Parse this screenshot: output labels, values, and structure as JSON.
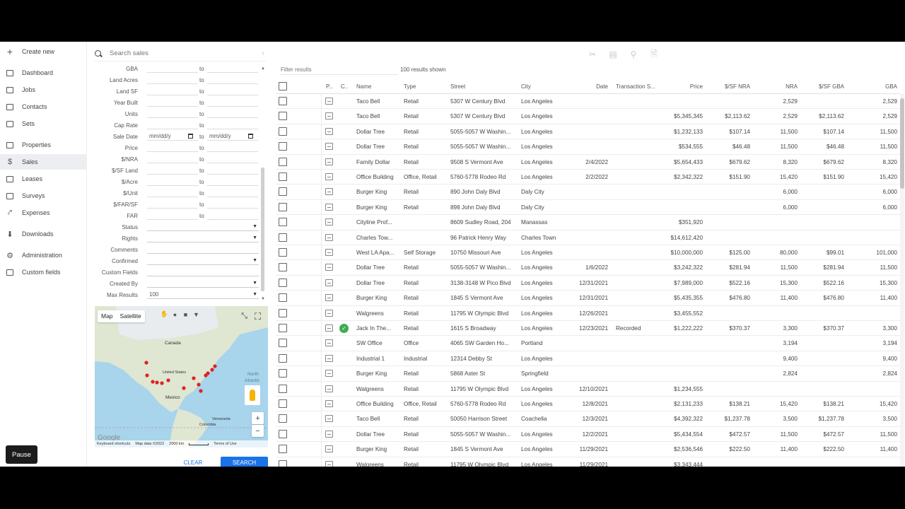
{
  "nav": {
    "create": "Create new",
    "items": [
      {
        "label": "Dashboard",
        "icon": "dashboard-icon"
      },
      {
        "label": "Jobs",
        "icon": "jobs-icon"
      },
      {
        "label": "Contacts",
        "icon": "contacts-icon"
      },
      {
        "label": "Sets",
        "icon": "sets-icon"
      },
      {
        "label": "Properties",
        "icon": "properties-icon"
      },
      {
        "label": "Sales",
        "icon": "dollar-icon",
        "active": true
      },
      {
        "label": "Leases",
        "icon": "leases-icon"
      },
      {
        "label": "Surveys",
        "icon": "surveys-icon"
      },
      {
        "label": "Expenses",
        "icon": "expenses-icon"
      },
      {
        "label": "Downloads",
        "icon": "download-icon"
      },
      {
        "label": "Administration",
        "icon": "gear-icon"
      },
      {
        "label": "Custom fields",
        "icon": "custom-fields-icon"
      }
    ],
    "pause": "Pause"
  },
  "panel": {
    "search_placeholder": "Search sales",
    "to": "to",
    "date_placeholder": "mm/dd/y",
    "filters": [
      "GBA",
      "Land Acres",
      "Land SF",
      "Year Built",
      "Units",
      "Cap Rate",
      "Sale Date",
      "Price",
      "$/NRA",
      "$/SF Land",
      "$/Acre",
      "$/Unit",
      "$/FAR/SF",
      "FAR"
    ],
    "selects": [
      {
        "label": "Status",
        "value": ""
      },
      {
        "label": "Rights",
        "value": ""
      },
      {
        "label": "Comments",
        "value": ""
      },
      {
        "label": "Confirmed",
        "value": ""
      },
      {
        "label": "Custom Fields",
        "value": ""
      },
      {
        "label": "Created By",
        "value": ""
      },
      {
        "label": "Max Results",
        "value": "100"
      }
    ],
    "map": {
      "map_label": "Map",
      "satellite_label": "Satellite",
      "labels": {
        "canada": "Canada",
        "us": "United States",
        "mexico": "Mexico",
        "north": "North",
        "atlantic": "Atlantic",
        "venezuela": "Venezuela",
        "colombia": "Colombia"
      },
      "footer": {
        "shortcuts": "Keyboard shortcuts",
        "data": "Map data ©2022",
        "scale": "2000 km",
        "terms": "Terms of Use"
      },
      "google": "Google"
    },
    "clear": "CLEAR",
    "search": "SEARCH"
  },
  "results": {
    "filter_placeholder": "Filter results",
    "count": "100 results shown",
    "headers": {
      "p": "P...",
      "c": "C...",
      "name": "Name",
      "type": "Type",
      "street": "Street",
      "city": "City",
      "date": "Date",
      "trans": "Transaction S...",
      "price": "Price",
      "sfnra": "$/SF NRA",
      "nra": "NRA",
      "sfgba": "$/SF GBA",
      "gba": "GBA"
    },
    "rows": [
      {
        "name": "Taco Bell",
        "type": "Retail",
        "street": "5307 W Century Blvd",
        "city": "Los Angeles",
        "date": "",
        "trans": "",
        "price": "",
        "sfnra": "",
        "nra": "2,529",
        "sfgba": "",
        "gba": "2,529",
        "check": false
      },
      {
        "name": "Taco Bell",
        "type": "Retail",
        "street": "5307 W Century Blvd",
        "city": "Los Angeles",
        "date": "",
        "trans": "",
        "price": "$5,345,345",
        "sfnra": "$2,113.62",
        "nra": "2,529",
        "sfgba": "$2,113.62",
        "gba": "2,529",
        "check": false
      },
      {
        "name": "Dollar Tree",
        "type": "Retail",
        "street": "5055-5057 W Washin...",
        "city": "Los Angeles",
        "date": "",
        "trans": "",
        "price": "$1,232,133",
        "sfnra": "$107.14",
        "nra": "11,500",
        "sfgba": "$107.14",
        "gba": "11,500",
        "check": false
      },
      {
        "name": "Dollar Tree",
        "type": "Retail",
        "street": "5055-5057 W Washin...",
        "city": "Los Angeles",
        "date": "",
        "trans": "",
        "price": "$534,555",
        "sfnra": "$46.48",
        "nra": "11,500",
        "sfgba": "$46.48",
        "gba": "11,500",
        "check": false
      },
      {
        "name": "Family Dollar",
        "type": "Retail",
        "street": "9508 S Vermont Ave",
        "city": "Los Angeles",
        "date": "2/4/2022",
        "trans": "",
        "price": "$5,654,433",
        "sfnra": "$679.62",
        "nra": "8,320",
        "sfgba": "$679.62",
        "gba": "8,320",
        "check": false
      },
      {
        "name": "Office Building",
        "type": "Office, Retail",
        "street": "5760-5778 Rodeo Rd",
        "city": "Los Angeles",
        "date": "2/2/2022",
        "trans": "",
        "price": "$2,342,322",
        "sfnra": "$151.90",
        "nra": "15,420",
        "sfgba": "$151.90",
        "gba": "15,420",
        "check": false
      },
      {
        "name": "Burger King",
        "type": "Retail",
        "street": "890 John Daly Blvd",
        "city": "Daly City",
        "date": "",
        "trans": "",
        "price": "",
        "sfnra": "",
        "nra": "6,000",
        "sfgba": "",
        "gba": "6,000",
        "check": false
      },
      {
        "name": "Burger King",
        "type": "Retail",
        "street": "898 John Daly Blvd",
        "city": "Daly City",
        "date": "",
        "trans": "",
        "price": "",
        "sfnra": "",
        "nra": "6,000",
        "sfgba": "",
        "gba": "6,000",
        "check": false
      },
      {
        "name": "Cityline Prof...",
        "type": "",
        "street": "8609 Sudley Road, 204",
        "city": "Manassas",
        "date": "",
        "trans": "",
        "price": "$351,920",
        "sfnra": "",
        "nra": "",
        "sfgba": "",
        "gba": "",
        "check": false
      },
      {
        "name": "Charles Tow...",
        "type": "",
        "street": "96 Patrick Henry Way",
        "city": "Charles Town",
        "date": "",
        "trans": "",
        "price": "$14,612,420",
        "sfnra": "",
        "nra": "",
        "sfgba": "",
        "gba": "",
        "check": false
      },
      {
        "name": "West LA Apa...",
        "type": "Self Storage",
        "street": "10750 Missouri Ave",
        "city": "Los Angeles",
        "date": "",
        "trans": "",
        "price": "$10,000,000",
        "sfnra": "$125.00",
        "nra": "80,000",
        "sfgba": "$99.01",
        "gba": "101,000",
        "check": false
      },
      {
        "name": "Dollar Tree",
        "type": "Retail",
        "street": "5055-5057 W Washin...",
        "city": "Los Angeles",
        "date": "1/6/2022",
        "trans": "",
        "price": "$3,242,322",
        "sfnra": "$281.94",
        "nra": "11,500",
        "sfgba": "$281.94",
        "gba": "11,500",
        "check": false
      },
      {
        "name": "Dollar Tree",
        "type": "Retail",
        "street": "3138-3148 W Pico Blvd",
        "city": "Los Angeles",
        "date": "12/31/2021",
        "trans": "",
        "price": "$7,989,000",
        "sfnra": "$522.16",
        "nra": "15,300",
        "sfgba": "$522.16",
        "gba": "15,300",
        "check": false
      },
      {
        "name": "Burger King",
        "type": "Retail",
        "street": "1845 S Vermont Ave",
        "city": "Los Angeles",
        "date": "12/31/2021",
        "trans": "",
        "price": "$5,435,355",
        "sfnra": "$476.80",
        "nra": "11,400",
        "sfgba": "$476.80",
        "gba": "11,400",
        "check": false
      },
      {
        "name": "Walgreens",
        "type": "Retail",
        "street": "11795 W Olympic Blvd",
        "city": "Los Angeles",
        "date": "12/26/2021",
        "trans": "",
        "price": "$3,455,552",
        "sfnra": "",
        "nra": "",
        "sfgba": "",
        "gba": "",
        "check": false
      },
      {
        "name": "Jack In The...",
        "type": "Retail",
        "street": "1615 S Broadway",
        "city": "Los Angeles",
        "date": "12/23/2021",
        "trans": "Recorded",
        "price": "$1,222,222",
        "sfnra": "$370.37",
        "nra": "3,300",
        "sfgba": "$370.37",
        "gba": "3,300",
        "check": true
      },
      {
        "name": "SW Office",
        "type": "Office",
        "street": "4065 SW Garden Ho...",
        "city": "Portland",
        "date": "",
        "trans": "",
        "price": "",
        "sfnra": "",
        "nra": "3,194",
        "sfgba": "",
        "gba": "3,194",
        "check": false
      },
      {
        "name": "Industrial 1",
        "type": "Industrial",
        "street": "12314 Debby St",
        "city": "Los Angeles",
        "date": "",
        "trans": "",
        "price": "",
        "sfnra": "",
        "nra": "9,400",
        "sfgba": "",
        "gba": "9,400",
        "check": false
      },
      {
        "name": "Burger King",
        "type": "Retail",
        "street": "5868 Aster St",
        "city": "Springfield",
        "date": "",
        "trans": "",
        "price": "",
        "sfnra": "",
        "nra": "2,824",
        "sfgba": "",
        "gba": "2,824",
        "check": false
      },
      {
        "name": "Walgreens",
        "type": "Retail",
        "street": "11795 W Olympic Blvd",
        "city": "Los Angeles",
        "date": "12/10/2021",
        "trans": "",
        "price": "$1,234,555",
        "sfnra": "",
        "nra": "",
        "sfgba": "",
        "gba": "",
        "check": false
      },
      {
        "name": "Office Building",
        "type": "Office, Retail",
        "street": "5760-5778 Rodeo Rd",
        "city": "Los Angeles",
        "date": "12/8/2021",
        "trans": "",
        "price": "$2,131,233",
        "sfnra": "$138.21",
        "nra": "15,420",
        "sfgba": "$138.21",
        "gba": "15,420",
        "check": false
      },
      {
        "name": "Taco Bell",
        "type": "Retail",
        "street": "50050 Harrison Street",
        "city": "Coachella",
        "date": "12/3/2021",
        "trans": "",
        "price": "$4,392,322",
        "sfnra": "$1,237.78",
        "nra": "3,500",
        "sfgba": "$1,237.78",
        "gba": "3,500",
        "check": false
      },
      {
        "name": "Dollar Tree",
        "type": "Retail",
        "street": "5055-5057 W Washin...",
        "city": "Los Angeles",
        "date": "12/2/2021",
        "trans": "",
        "price": "$5,434,554",
        "sfnra": "$472.57",
        "nra": "11,500",
        "sfgba": "$472.57",
        "gba": "11,500",
        "check": false
      },
      {
        "name": "Burger King",
        "type": "Retail",
        "street": "1845 S Vermont Ave",
        "city": "Los Angeles",
        "date": "11/29/2021",
        "trans": "",
        "price": "$2,536,546",
        "sfnra": "$222.50",
        "nra": "11,400",
        "sfgba": "$222.50",
        "gba": "11,400",
        "check": false
      },
      {
        "name": "Walgreens",
        "type": "Retail",
        "street": "11795 W Olympic Blvd",
        "city": "Los Angeles",
        "date": "11/29/2021",
        "trans": "",
        "price": "$3,343,444",
        "sfnra": "",
        "nra": "",
        "sfgba": "",
        "gba": "",
        "check": false
      }
    ]
  }
}
